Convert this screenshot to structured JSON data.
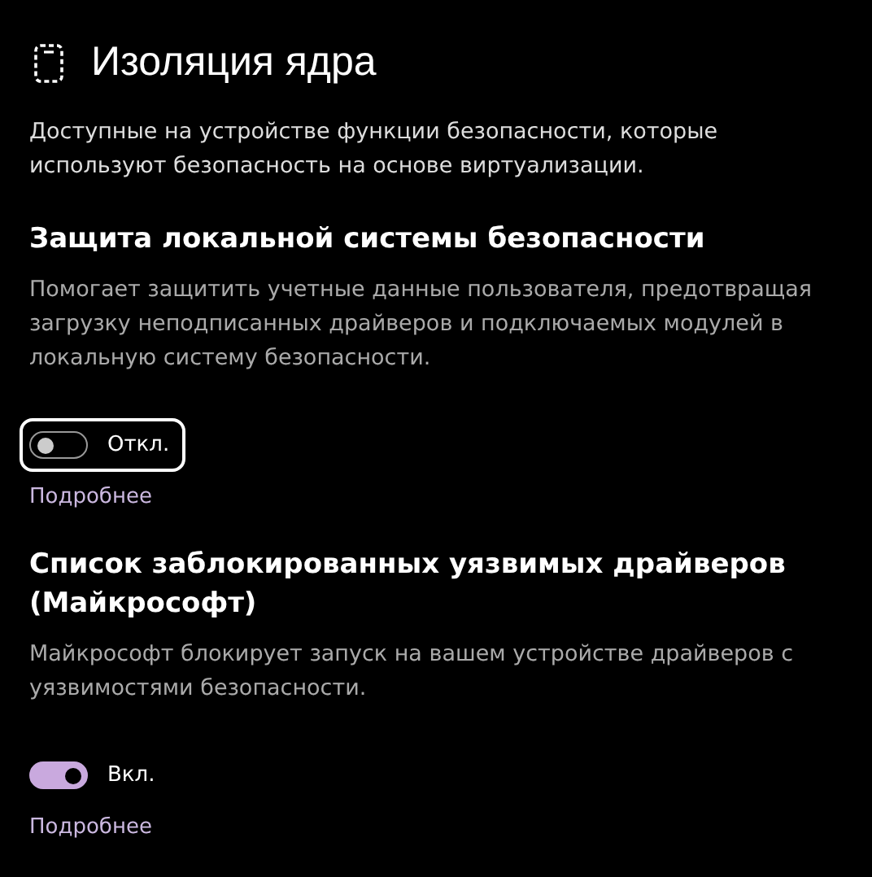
{
  "title": "Изоляция ядра",
  "description": "Доступные на устройстве функции безопасности, которые используют безопасность на основе виртуализации.",
  "sections": [
    {
      "heading": "Защита локальной системы безопасности",
      "text": "Помогает защитить учетные данные пользователя, предотвращая загрузку неподписанных драйверов и подключаемых модулей в локальную систему безопасности.",
      "toggle": {
        "on": false,
        "focused": true,
        "label": "Откл."
      },
      "link": "Подробнее"
    },
    {
      "heading": "Список заблокированных уязвимых драйверов (Майкрософт)",
      "text": "Майкрософт блокирует запуск на вашем устройстве драйверов с уязвимостями безопасности.",
      "toggle": {
        "on": true,
        "focused": false,
        "label": "Вкл."
      },
      "link": "Подробнее"
    }
  ]
}
